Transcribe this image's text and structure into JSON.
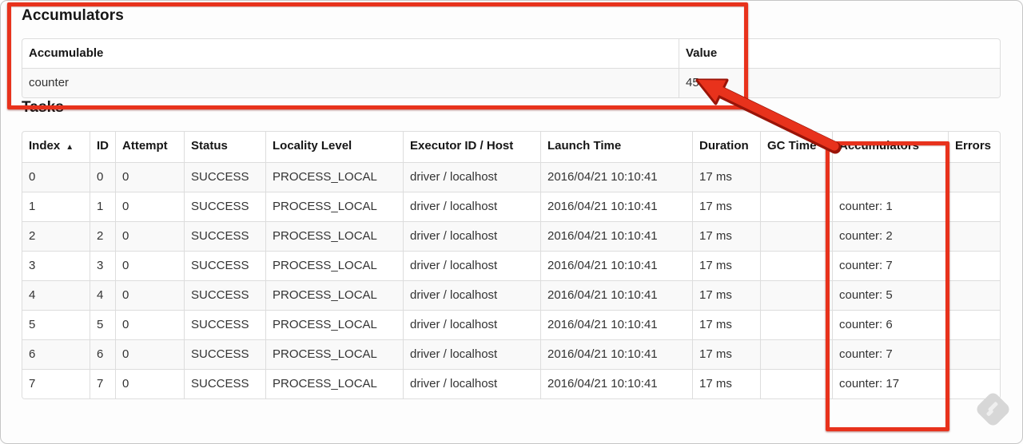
{
  "accumulators_section": {
    "title": "Accumulators",
    "table": {
      "columns": [
        {
          "label": "Accumulable"
        },
        {
          "label": "Value"
        }
      ],
      "rows": [
        [
          "counter",
          "45"
        ]
      ]
    }
  },
  "tasks_section": {
    "title": "Tasks",
    "table": {
      "columns": [
        {
          "label": "Index",
          "sort_icon": "▲"
        },
        {
          "label": "ID"
        },
        {
          "label": "Attempt"
        },
        {
          "label": "Status"
        },
        {
          "label": "Locality Level"
        },
        {
          "label": "Executor ID / Host"
        },
        {
          "label": "Launch Time"
        },
        {
          "label": "Duration"
        },
        {
          "label": "GC Time"
        },
        {
          "label": "Accumulators"
        },
        {
          "label": "Errors"
        }
      ],
      "rows": [
        [
          "0",
          "0",
          "0",
          "SUCCESS",
          "PROCESS_LOCAL",
          "driver / localhost",
          "2016/04/21 10:10:41",
          "17 ms",
          "",
          "",
          ""
        ],
        [
          "1",
          "1",
          "0",
          "SUCCESS",
          "PROCESS_LOCAL",
          "driver / localhost",
          "2016/04/21 10:10:41",
          "17 ms",
          "",
          "counter: 1",
          ""
        ],
        [
          "2",
          "2",
          "0",
          "SUCCESS",
          "PROCESS_LOCAL",
          "driver / localhost",
          "2016/04/21 10:10:41",
          "17 ms",
          "",
          "counter: 2",
          ""
        ],
        [
          "3",
          "3",
          "0",
          "SUCCESS",
          "PROCESS_LOCAL",
          "driver / localhost",
          "2016/04/21 10:10:41",
          "17 ms",
          "",
          "counter: 7",
          ""
        ],
        [
          "4",
          "4",
          "0",
          "SUCCESS",
          "PROCESS_LOCAL",
          "driver / localhost",
          "2016/04/21 10:10:41",
          "17 ms",
          "",
          "counter: 5",
          ""
        ],
        [
          "5",
          "5",
          "0",
          "SUCCESS",
          "PROCESS_LOCAL",
          "driver / localhost",
          "2016/04/21 10:10:41",
          "17 ms",
          "",
          "counter: 6",
          ""
        ],
        [
          "6",
          "6",
          "0",
          "SUCCESS",
          "PROCESS_LOCAL",
          "driver / localhost",
          "2016/04/21 10:10:41",
          "17 ms",
          "",
          "counter: 7",
          ""
        ],
        [
          "7",
          "7",
          "0",
          "SUCCESS",
          "PROCESS_LOCAL",
          "driver / localhost",
          "2016/04/21 10:10:41",
          "17 ms",
          "",
          "counter: 17",
          ""
        ]
      ]
    }
  },
  "annotations": {
    "color": "#e8321c",
    "items": [
      "highlight-box-around-accumulators-table",
      "highlight-box-around-accumulators-column",
      "arrow-from-accumulators-column-to-total-value"
    ]
  },
  "watermark_color": "#d7d7d7"
}
